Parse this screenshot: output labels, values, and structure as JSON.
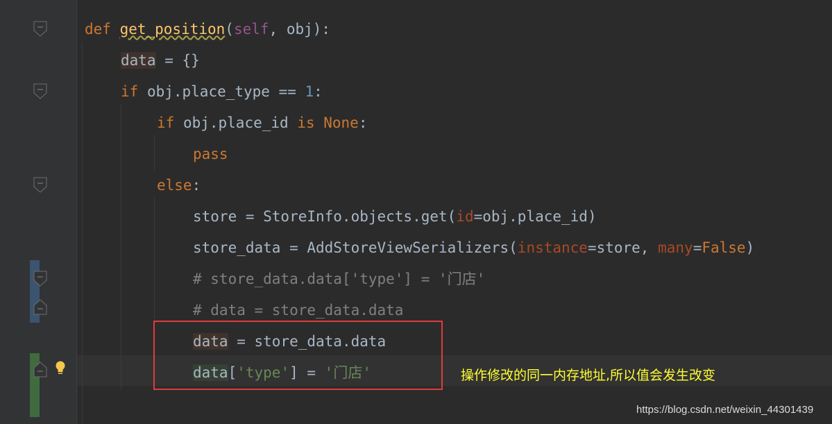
{
  "editor": {
    "lines": [
      {
        "tokens": [
          {
            "t": "def ",
            "c": "kw"
          },
          {
            "t": "get_position",
            "c": "fn"
          },
          {
            "t": "(",
            "c": ""
          },
          {
            "t": "self",
            "c": "self"
          },
          {
            "t": ", obj):",
            "c": ""
          }
        ]
      },
      {
        "tokens": [
          {
            "t": "data",
            "c": "hl-write"
          },
          {
            "t": " = {}",
            "c": ""
          }
        ]
      },
      {
        "tokens": [
          {
            "t": "if ",
            "c": "kw"
          },
          {
            "t": "obj.place_type == ",
            "c": ""
          },
          {
            "t": "1",
            "c": "num"
          },
          {
            "t": ":",
            "c": ""
          }
        ]
      },
      {
        "tokens": [
          {
            "t": "if ",
            "c": "kw"
          },
          {
            "t": "obj.place_id ",
            "c": ""
          },
          {
            "t": "is None",
            "c": "kw"
          },
          {
            "t": ":",
            "c": ""
          }
        ]
      },
      {
        "tokens": [
          {
            "t": "pass",
            "c": "kw"
          }
        ]
      },
      {
        "tokens": [
          {
            "t": "else",
            "c": "kw"
          },
          {
            "t": ":",
            "c": ""
          }
        ]
      },
      {
        "tokens": [
          {
            "t": "store = StoreInfo.objects.get(",
            "c": ""
          },
          {
            "t": "id",
            "c": "param"
          },
          {
            "t": "=obj.place_id)",
            "c": ""
          }
        ]
      },
      {
        "tokens": [
          {
            "t": "store_data = AddStoreViewSerializers(",
            "c": ""
          },
          {
            "t": "instance",
            "c": "param"
          },
          {
            "t": "=store, ",
            "c": ""
          },
          {
            "t": "many",
            "c": "param"
          },
          {
            "t": "=",
            "c": ""
          },
          {
            "t": "False",
            "c": "kw"
          },
          {
            "t": ")",
            "c": ""
          }
        ]
      },
      {
        "tokens": [
          {
            "t": "# store_data.data['type'] = '门店'",
            "c": "com"
          }
        ]
      },
      {
        "tokens": [
          {
            "t": "# data = store_data.data",
            "c": "com"
          }
        ]
      },
      {
        "tokens": [
          {
            "t": "data",
            "c": "hl-write"
          },
          {
            "t": " = store_data.data",
            "c": ""
          }
        ]
      },
      {
        "tokens": [
          {
            "t": "data",
            "c": "hl-read"
          },
          {
            "t": "[",
            "c": ""
          },
          {
            "t": "'type'",
            "c": "str"
          },
          {
            "t": "] = ",
            "c": ""
          },
          {
            "t": "'门店'",
            "c": "str"
          }
        ]
      }
    ]
  },
  "annotation": {
    "text": "操作修改的同一内存地址,所以值会发生改变",
    "color": "#ffff33"
  },
  "watermark": {
    "text": "https://blog.csdn.net/weixin_44301439"
  },
  "colors": {
    "background": "#2b2b2b",
    "keyword": "#cc7832",
    "function": "#ffc66d",
    "string": "#6a8759",
    "comment": "#808080",
    "box": "#e03c3c"
  }
}
